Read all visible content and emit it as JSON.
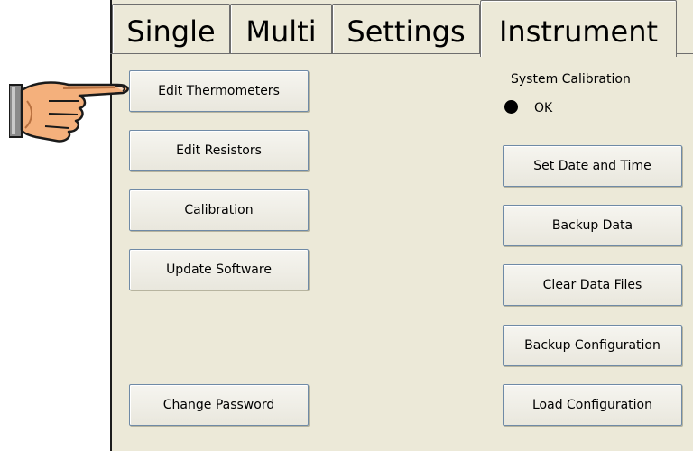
{
  "tabs": [
    {
      "label": "Single"
    },
    {
      "label": "Multi"
    },
    {
      "label": "Settings"
    },
    {
      "label": "Instrument",
      "active": true
    }
  ],
  "left_buttons": [
    {
      "label": "Edit Thermometers"
    },
    {
      "label": "Edit Resistors"
    },
    {
      "label": "Calibration"
    },
    {
      "label": "Update Software"
    },
    {
      "label": "Change Password"
    }
  ],
  "system_calibration": {
    "title": "System Calibration",
    "status": "OK",
    "status_color": "#000000"
  },
  "right_buttons": [
    {
      "label": "Set Date and Time"
    },
    {
      "label": "Backup Data"
    },
    {
      "label": "Clear Data Files"
    },
    {
      "label": "Backup Configuration"
    },
    {
      "label": "Load Configuration"
    }
  ],
  "pointer": {
    "icon": "pointing-hand-icon"
  }
}
